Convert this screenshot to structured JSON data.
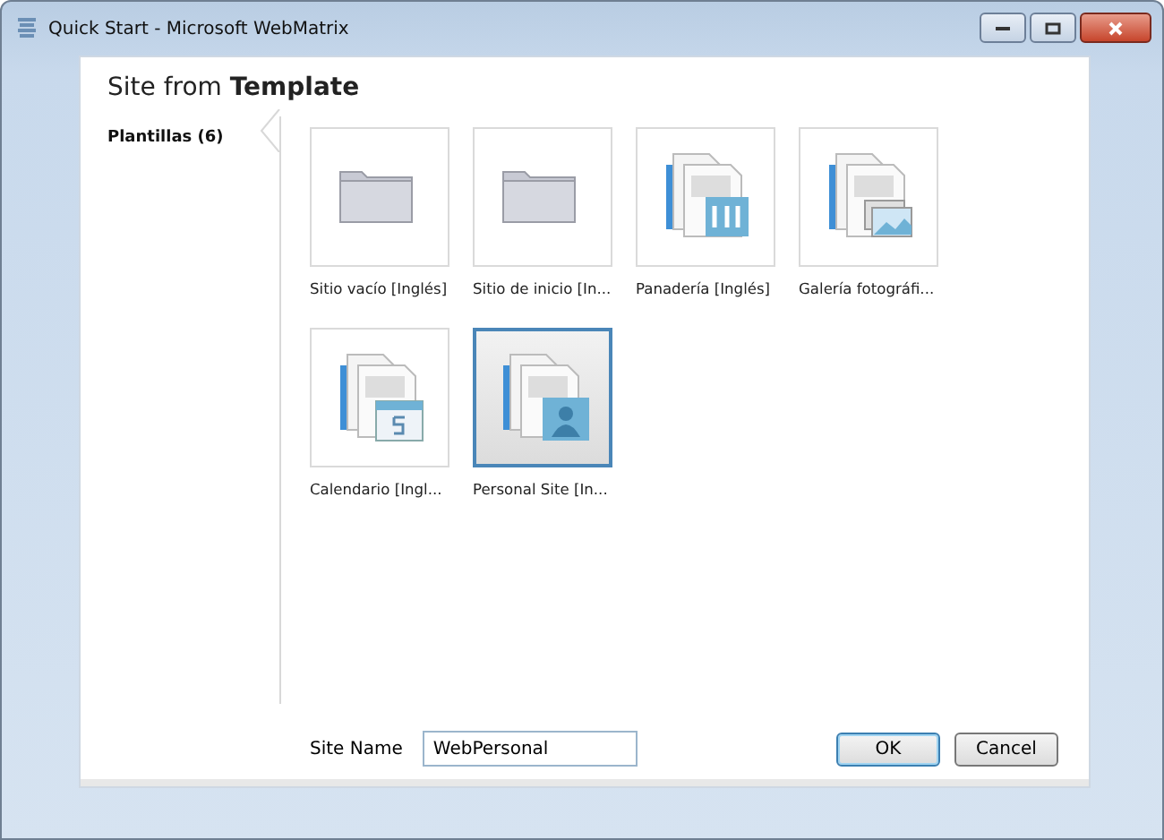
{
  "window": {
    "title": "Quick Start - Microsoft WebMatrix"
  },
  "heading": "Site from **Template**",
  "sidebar": {
    "items": [
      {
        "label": "Plantillas (6)",
        "selected": true
      }
    ]
  },
  "templates": [
    {
      "label": "Sitio vacío [Inglés]",
      "kind": "folder",
      "selected": false
    },
    {
      "label": "Sitio de inicio [In...",
      "kind": "folder",
      "selected": false
    },
    {
      "label": "Panadería [Inglés]",
      "kind": "restaurant",
      "selected": false
    },
    {
      "label": "Galería fotográfi...",
      "kind": "gallery",
      "selected": false
    },
    {
      "label": "Calendario [Ingl...",
      "kind": "calendar",
      "selected": false
    },
    {
      "label": "Personal Site [In...",
      "kind": "person",
      "selected": true
    }
  ],
  "site_name": {
    "label": "Site Name",
    "value": "WebPersonal"
  },
  "buttons": [
    {
      "label": "OK",
      "kind": "default"
    },
    {
      "label": "Cancel",
      "kind": "normal"
    }
  ]
}
